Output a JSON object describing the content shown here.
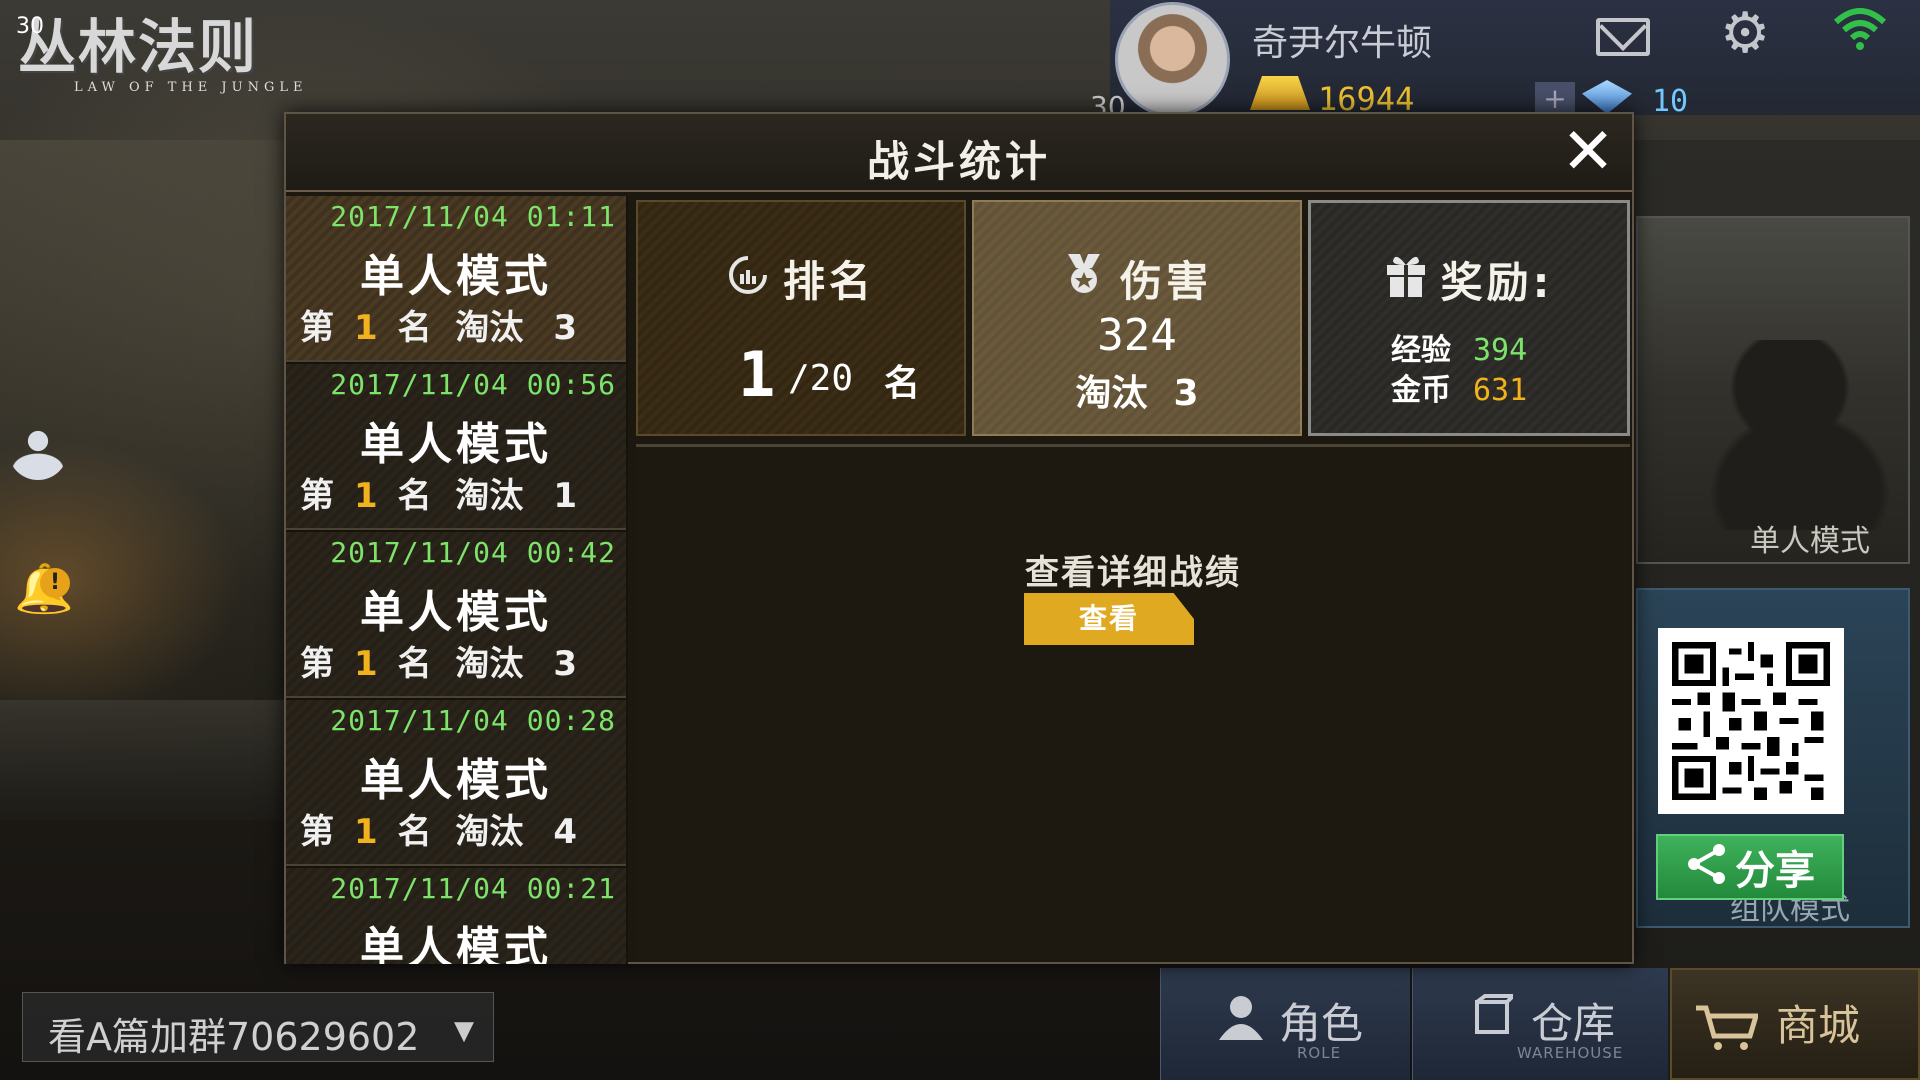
{
  "status": {
    "fps": "30"
  },
  "logo": {
    "title": "丛林法则",
    "subtitle": "LAW OF THE JUNGLE"
  },
  "profile": {
    "name": "奇尹尔牛顿",
    "level_partial": "30",
    "gold": "16944",
    "gems": "10",
    "plus_label": "+",
    "icons": [
      "mail-icon",
      "gear-icon",
      "wifi-icon"
    ]
  },
  "dialog": {
    "title": "战斗统计",
    "close_label": "✕",
    "records": [
      {
        "time": "2017/11/04 01:11",
        "mode": "单人模式",
        "prefix": "第",
        "rank": "1",
        "rank_unit": "名",
        "kill_label": "淘汰",
        "kills": "3",
        "selected": true
      },
      {
        "time": "2017/11/04 00:56",
        "mode": "单人模式",
        "prefix": "第",
        "rank": "1",
        "rank_unit": "名",
        "kill_label": "淘汰",
        "kills": "1",
        "selected": false
      },
      {
        "time": "2017/11/04 00:42",
        "mode": "单人模式",
        "prefix": "第",
        "rank": "1",
        "rank_unit": "名",
        "kill_label": "淘汰",
        "kills": "3",
        "selected": false
      },
      {
        "time": "2017/11/04 00:28",
        "mode": "单人模式",
        "prefix": "第",
        "rank": "1",
        "rank_unit": "名",
        "kill_label": "淘汰",
        "kills": "4",
        "selected": false
      },
      {
        "time": "2017/11/04 00:21",
        "mode": "单人模式",
        "prefix": "",
        "rank": "",
        "rank_unit": "",
        "kill_label": "",
        "kills": "",
        "selected": false
      }
    ],
    "rank_box": {
      "label": "排名",
      "value": "1",
      "total": "/20",
      "unit": "名"
    },
    "damage_box": {
      "label": "伤害",
      "value": "324",
      "kill_label": "淘汰",
      "kills": "3"
    },
    "reward_box": {
      "label": "奖励:",
      "exp_label": "经验",
      "exp_value": "394",
      "gold_label": "金币",
      "gold_value": "631"
    },
    "detail": {
      "text": "查看详细战绩",
      "button_label": "查看"
    }
  },
  "right_panel": {
    "single_mode_label": "单人模式",
    "team_mode_label": "组队模式",
    "share_label": "分享"
  },
  "chat": {
    "text": "看A篇加群70629602",
    "caret": "▼"
  },
  "nav": [
    {
      "label": "角色",
      "sub": "ROLE",
      "icon": "user-icon"
    },
    {
      "label": "仓库",
      "sub": "WAREHOUSE",
      "icon": "box-icon"
    },
    {
      "label": "商城",
      "sub": "",
      "icon": "cart-icon"
    }
  ],
  "colors": {
    "accent_gold": "#f2b21c",
    "time_green": "#7de36a",
    "share_green": "#2f9e4a",
    "view_button": "#e0a922"
  }
}
